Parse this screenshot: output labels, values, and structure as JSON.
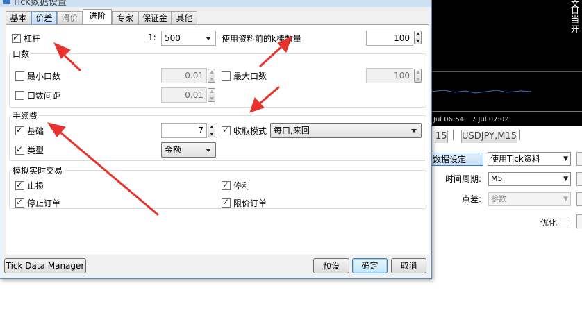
{
  "dialog": {
    "title": "Tick数据设置",
    "tabs": [
      {
        "label": "基本"
      },
      {
        "label": "价差"
      },
      {
        "label": "滑价"
      },
      {
        "label": "进阶"
      },
      {
        "label": "专家"
      },
      {
        "label": "保证金"
      },
      {
        "label": "其他"
      }
    ],
    "active_tab": "进阶",
    "leverage": {
      "label": "杠杆",
      "checked": true,
      "ratio_prefix": "1:",
      "value": "500"
    },
    "kbars": {
      "label": "使用资料前的k棒数量",
      "value": "100"
    },
    "lots": {
      "group_title": "口数",
      "min_label": "最小口数",
      "min_value": "0.01",
      "max_label": "最大口数",
      "max_value": "100",
      "step_label": "口数间距",
      "step_value": "0.01"
    },
    "commission": {
      "group_title": "手续费",
      "base_label": "基础",
      "base_value": "7",
      "mode_label": "收取模式",
      "mode_value": "每口,来回",
      "type_label": "类型",
      "type_value": "金额"
    },
    "simulation": {
      "group_title": "模拟实时交易",
      "stop_loss": "止损",
      "take_profit": "停利",
      "stop_orders": "停止订单",
      "limit_orders": "限价订单"
    },
    "buttons": {
      "tick_manager": "Tick Data Manager",
      "preset": "预设",
      "ok": "确定",
      "cancel": "取消"
    }
  },
  "background": {
    "chart_text": [
      "文",
      "日",
      "当",
      "开"
    ],
    "time_labels": [
      "Jul 06:54",
      "7 Jul 07:02"
    ],
    "chart_tabs": [
      "15",
      "USDJPY,M15"
    ],
    "tester": {
      "settings_button": "数据设定",
      "model_value": "使用Tick资料",
      "period_label": "时间周期:",
      "period_value": "M5",
      "spread_label": "点差:",
      "spread_value": "参数",
      "optimize_label": "优化"
    }
  },
  "colors": {
    "arrow": "#e8322d",
    "default_button": "#3c7fb1",
    "chart_line": "#3a73c6"
  }
}
